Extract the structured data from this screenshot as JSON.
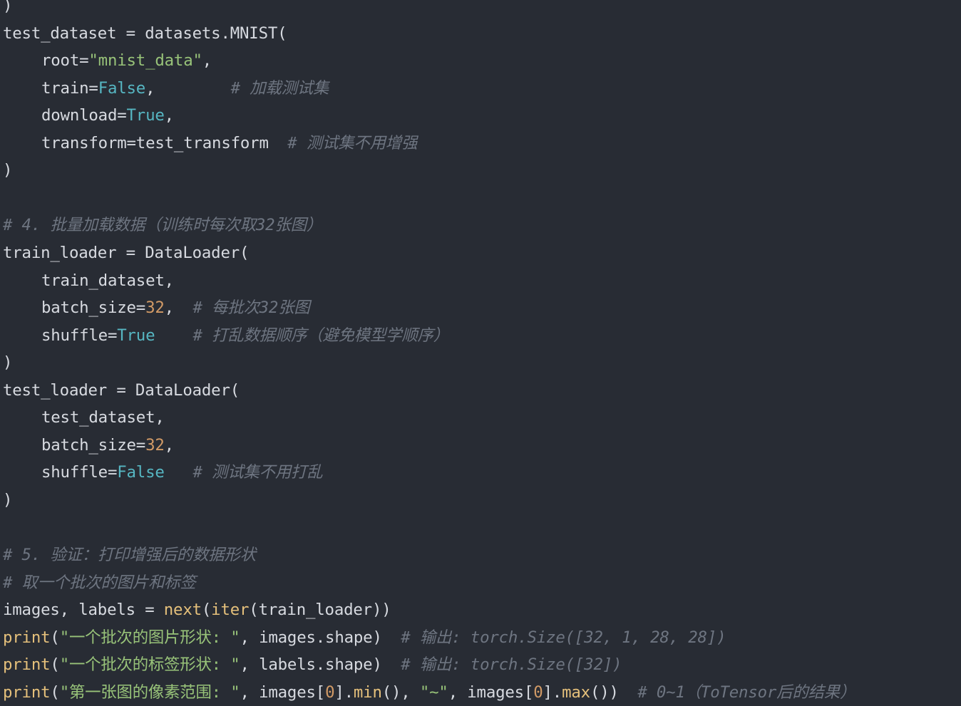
{
  "colors": {
    "background": "#282c34",
    "text": "#d7dae0",
    "string": "#98c379",
    "boolean": "#56b6c2",
    "number": "#d19a66",
    "function": "#e5c07b",
    "comment": "#6e7581"
  },
  "code": {
    "lines": [
      {
        "tokens": [
          {
            "t": "plain",
            "v": ")"
          }
        ]
      },
      {
        "tokens": [
          {
            "t": "plain",
            "v": "test_dataset = datasets.MNIST("
          }
        ]
      },
      {
        "indent": true,
        "tokens": [
          {
            "t": "plain",
            "v": "root="
          },
          {
            "t": "str",
            "v": "\"mnist_data\""
          },
          {
            "t": "plain",
            "v": ","
          }
        ]
      },
      {
        "indent": true,
        "tokens": [
          {
            "t": "plain",
            "v": "train="
          },
          {
            "t": "bool",
            "v": "False"
          },
          {
            "t": "plain",
            "v": ",        "
          },
          {
            "t": "comment",
            "v": "# 加载测试集"
          }
        ]
      },
      {
        "indent": true,
        "tokens": [
          {
            "t": "plain",
            "v": "download="
          },
          {
            "t": "bool",
            "v": "True"
          },
          {
            "t": "plain",
            "v": ","
          }
        ]
      },
      {
        "indent": true,
        "tokens": [
          {
            "t": "plain",
            "v": "transform=test_transform  "
          },
          {
            "t": "comment",
            "v": "# 测试集不用增强"
          }
        ]
      },
      {
        "tokens": [
          {
            "t": "plain",
            "v": ")"
          }
        ]
      },
      {
        "tokens": []
      },
      {
        "tokens": [
          {
            "t": "comment",
            "v": "# 4. 批量加载数据（训练时每次取32张图）"
          }
        ]
      },
      {
        "tokens": [
          {
            "t": "plain",
            "v": "train_loader = DataLoader("
          }
        ]
      },
      {
        "indent": true,
        "tokens": [
          {
            "t": "plain",
            "v": "train_dataset,"
          }
        ]
      },
      {
        "indent": true,
        "tokens": [
          {
            "t": "plain",
            "v": "batch_size="
          },
          {
            "t": "num",
            "v": "32"
          },
          {
            "t": "plain",
            "v": ",  "
          },
          {
            "t": "comment",
            "v": "# 每批次32张图"
          }
        ]
      },
      {
        "indent": true,
        "tokens": [
          {
            "t": "plain",
            "v": "shuffle="
          },
          {
            "t": "bool",
            "v": "True"
          },
          {
            "t": "plain",
            "v": "    "
          },
          {
            "t": "comment",
            "v": "# 打乱数据顺序（避免模型学顺序）"
          }
        ]
      },
      {
        "tokens": [
          {
            "t": "plain",
            "v": ")"
          }
        ]
      },
      {
        "tokens": [
          {
            "t": "plain",
            "v": "test_loader = DataLoader("
          }
        ]
      },
      {
        "indent": true,
        "tokens": [
          {
            "t": "plain",
            "v": "test_dataset,"
          }
        ]
      },
      {
        "indent": true,
        "tokens": [
          {
            "t": "plain",
            "v": "batch_size="
          },
          {
            "t": "num",
            "v": "32"
          },
          {
            "t": "plain",
            "v": ","
          }
        ]
      },
      {
        "indent": true,
        "tokens": [
          {
            "t": "plain",
            "v": "shuffle="
          },
          {
            "t": "bool",
            "v": "False"
          },
          {
            "t": "plain",
            "v": "   "
          },
          {
            "t": "comment",
            "v": "# 测试集不用打乱"
          }
        ]
      },
      {
        "tokens": [
          {
            "t": "plain",
            "v": ")"
          }
        ]
      },
      {
        "tokens": []
      },
      {
        "tokens": [
          {
            "t": "comment",
            "v": "# 5. 验证：打印增强后的数据形状"
          }
        ]
      },
      {
        "tokens": [
          {
            "t": "comment",
            "v": "# 取一个批次的图片和标签"
          }
        ]
      },
      {
        "tokens": [
          {
            "t": "plain",
            "v": "images, labels = "
          },
          {
            "t": "fn",
            "v": "next"
          },
          {
            "t": "plain",
            "v": "("
          },
          {
            "t": "fn",
            "v": "iter"
          },
          {
            "t": "plain",
            "v": "(train_loader))"
          }
        ]
      },
      {
        "tokens": [
          {
            "t": "fn",
            "v": "print"
          },
          {
            "t": "plain",
            "v": "("
          },
          {
            "t": "str",
            "v": "\"一个批次的图片形状: \""
          },
          {
            "t": "plain",
            "v": ", images.shape)  "
          },
          {
            "t": "comment",
            "v": "# 输出: torch.Size([32, 1, 28, 28])"
          }
        ]
      },
      {
        "tokens": [
          {
            "t": "fn",
            "v": "print"
          },
          {
            "t": "plain",
            "v": "("
          },
          {
            "t": "str",
            "v": "\"一个批次的标签形状: \""
          },
          {
            "t": "plain",
            "v": ", labels.shape)  "
          },
          {
            "t": "comment",
            "v": "# 输出: torch.Size([32])"
          }
        ]
      },
      {
        "tokens": [
          {
            "t": "fn",
            "v": "print"
          },
          {
            "t": "plain",
            "v": "("
          },
          {
            "t": "str",
            "v": "\"第一张图的像素范围: \""
          },
          {
            "t": "plain",
            "v": ", images["
          },
          {
            "t": "num",
            "v": "0"
          },
          {
            "t": "plain",
            "v": "]."
          },
          {
            "t": "fn",
            "v": "min"
          },
          {
            "t": "plain",
            "v": "(), "
          },
          {
            "t": "str",
            "v": "\"~\""
          },
          {
            "t": "plain",
            "v": ", images["
          },
          {
            "t": "num",
            "v": "0"
          },
          {
            "t": "plain",
            "v": "]."
          },
          {
            "t": "fn",
            "v": "max"
          },
          {
            "t": "plain",
            "v": "())  "
          },
          {
            "t": "comment",
            "v": "# 0~1（ToTensor后的结果）"
          }
        ]
      }
    ]
  }
}
